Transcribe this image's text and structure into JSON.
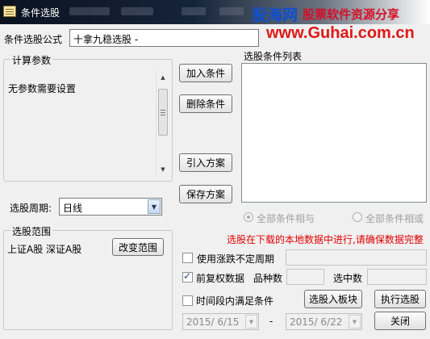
{
  "window": {
    "title": "条件选股"
  },
  "watermark": {
    "brand": "股海网",
    "slogan": "股票软件资源分享",
    "url": "www.Guhai.com.cn"
  },
  "formula": {
    "label": "条件选股公式",
    "value": "十拿九稳选股 -"
  },
  "params": {
    "group_title": "计算参数",
    "message": "无参数需要设置"
  },
  "buttons": {
    "add": "加入条件",
    "delete": "删除条件",
    "import": "引入方案",
    "save": "保存方案",
    "change_range": "改变范围",
    "to_block": "选股入板块",
    "execute": "执行选股",
    "close": "关闭"
  },
  "conditions": {
    "label": "选股条件列表",
    "items": []
  },
  "logic": {
    "and_label": "全部条件相与",
    "or_label": "全部条件相或",
    "selected": "and"
  },
  "period": {
    "label": "选股周期:",
    "value": "日线"
  },
  "range": {
    "group_title": "选股范围",
    "value": "上证A股  深证A股"
  },
  "notice": "选股在下载的本地数据中进行,请确保数据完整",
  "options": {
    "use_period": {
      "label": "使用涨跌不定周期",
      "checked": false
    },
    "fq": {
      "label": "前复权数据",
      "checked": true
    },
    "time_range": {
      "label": "时间段内满足条件",
      "checked": false
    }
  },
  "stats": {
    "variety_label": "品种数",
    "selected_label": "选中数"
  },
  "dates": {
    "from": "2015/ 6/15",
    "separator": "-",
    "to": "2015/ 6/22"
  },
  "colors": {
    "brand_blue": "#0e4fd0",
    "slogan_red": "#d4102a",
    "url_red": "#e01818",
    "notice_red": "#e00000"
  }
}
